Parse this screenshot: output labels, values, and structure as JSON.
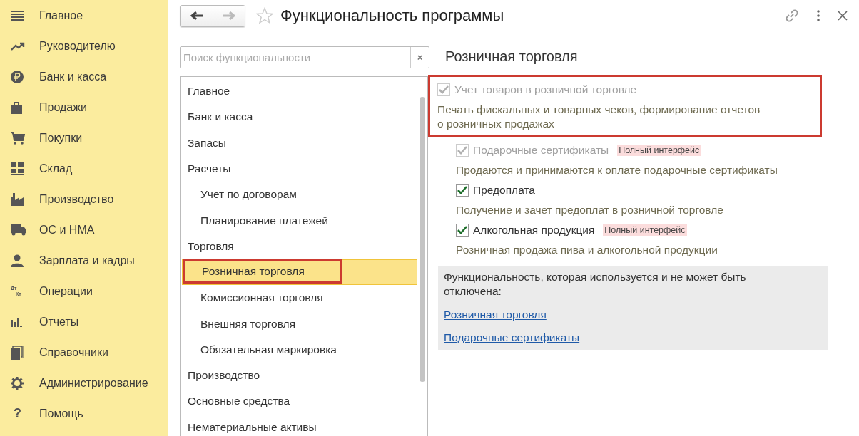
{
  "sidebar": {
    "items": [
      {
        "label": "Главное"
      },
      {
        "label": "Руководителю"
      },
      {
        "label": "Банк и касса"
      },
      {
        "label": "Продажи"
      },
      {
        "label": "Покупки"
      },
      {
        "label": "Склад"
      },
      {
        "label": "Производство"
      },
      {
        "label": "ОС и НМА"
      },
      {
        "label": "Зарплата и кадры"
      },
      {
        "label": "Операции",
        "icon_text": [
          "Дт",
          "Кт"
        ]
      },
      {
        "label": "Отчеты"
      },
      {
        "label": "Справочники"
      },
      {
        "label": "Администрирование"
      },
      {
        "label": "Помощь",
        "icon_text": [
          "?"
        ]
      }
    ]
  },
  "header": {
    "title": "Функциональность программы"
  },
  "search": {
    "placeholder": "Поиск функциональности",
    "clear": "×"
  },
  "sections": [
    {
      "label": "Главное",
      "selected": false
    },
    {
      "label": "Банк и касса",
      "selected": false
    },
    {
      "label": "Запасы",
      "selected": false
    },
    {
      "label": "Расчеты",
      "selected": false,
      "children": [
        {
          "label": "Учет по договорам",
          "selected": false
        },
        {
          "label": "Планирование платежей",
          "selected": false
        }
      ]
    },
    {
      "label": "Торговля",
      "selected": false,
      "children": [
        {
          "label": "Розничная торговля",
          "selected": true
        },
        {
          "label": "Комиссионная торговля",
          "selected": false
        },
        {
          "label": "Внешняя торговля",
          "selected": false
        },
        {
          "label": "Обязательная маркировка",
          "selected": false
        }
      ]
    },
    {
      "label": "Производство",
      "selected": false
    },
    {
      "label": "Основные средства",
      "selected": false
    },
    {
      "label": "Нематериальные активы",
      "selected": false
    }
  ],
  "content": {
    "heading": "Розничная торговля",
    "options": [
      {
        "label": "Учет товаров в розничной торговле",
        "checked": true,
        "disabled": true,
        "highlighted": true,
        "description": "Печать фискальных и товарных чеков, формирование отчетов\nо розничных продажах",
        "children": [
          {
            "label": "Подарочные сертификаты",
            "checked": true,
            "disabled": true,
            "badge": "Полный интерфейс",
            "description": "Продаются и принимаются к оплате подарочные сертификаты"
          },
          {
            "label": "Предоплата",
            "checked": true,
            "disabled": false,
            "description": "Получение и зачет предоплат в розничной торговле"
          },
          {
            "label": "Алкогольная продукция",
            "checked": true,
            "disabled": false,
            "badge": "Полный интерфейс",
            "description": "Розничная продажа пива и алкогольной продукции"
          }
        ]
      }
    ],
    "info": {
      "text": "Функциональность, которая используется и не может быть отключена:",
      "links": [
        "Розничная торговля",
        "Подарочные сертификаты"
      ]
    }
  }
}
